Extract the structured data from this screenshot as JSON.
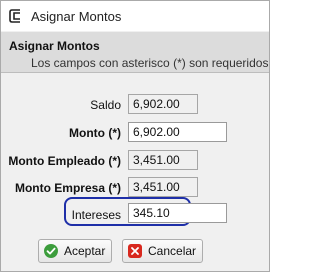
{
  "window": {
    "title": "Asignar Montos",
    "icon": "bracket-app-icon"
  },
  "header": {
    "title": "Asignar Montos",
    "subtitle": "Los campos con asterisco (*) son requeridos"
  },
  "form": {
    "saldo": {
      "label": "Saldo",
      "value": "6,902.00"
    },
    "monto": {
      "label": "Monto (*)",
      "value": "6,902.00"
    },
    "monto_empleado": {
      "label": "Monto Empleado (*)",
      "value": "3,451.00"
    },
    "monto_empresa": {
      "label": "Monto Empresa (*)",
      "value": "3,451.00"
    },
    "intereses": {
      "label": "Intereses",
      "value": "345.10"
    }
  },
  "buttons": {
    "accept": {
      "label": "Aceptar",
      "icon": "check-circle-icon"
    },
    "cancel": {
      "label": "Cancelar",
      "icon": "x-square-icon"
    }
  },
  "colors": {
    "highlight": "#1e2fa8",
    "accept_icon": "#3c9d3c",
    "cancel_icon": "#d8281e"
  }
}
